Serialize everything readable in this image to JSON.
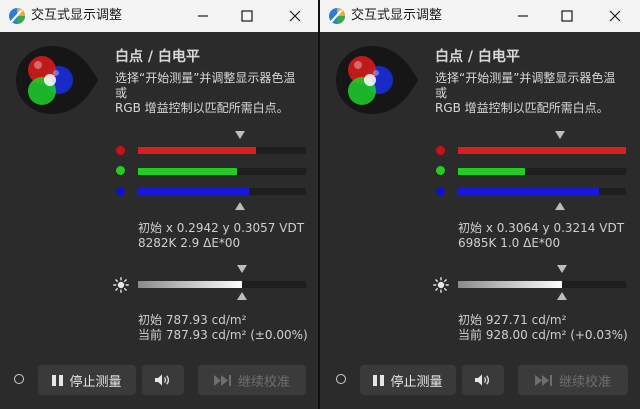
{
  "windows": [
    {
      "title": "交互式显示调整",
      "heading": "白点 / 白电平",
      "description": [
        "选择“开始测量”并调整显示器色温",
        "或",
        "RGB 增益控制以匹配所需白点。"
      ],
      "channels": [
        {
          "name": "red",
          "color": "#d81e1e",
          "dot_color": "#cc1111",
          "level": 0.7
        },
        {
          "name": "green",
          "color": "#22cc22",
          "dot_color": "#22cc22",
          "level": 0.59
        },
        {
          "name": "blue",
          "color": "#1818dd",
          "dot_color": "#1212cc",
          "level": 0.66
        }
      ],
      "target_marker": 0.61,
      "readout_color": [
        "初始 x 0.2942 y 0.3057 VDT",
        "8282K 2.9 ΔE*00"
      ],
      "brightness_level": 0.62,
      "brightness_marker": 0.62,
      "readout_luminance": [
        "初始 787.93 cd/m²",
        "当前 787.93 cd/m² (±0.00%)"
      ],
      "buttons": {
        "stop": "停止测量",
        "continue": "继续校准"
      }
    },
    {
      "title": "交互式显示调整",
      "heading": "白点 / 白电平",
      "description": [
        "选择“开始测量”并调整显示器色温",
        "或",
        "RGB 增益控制以匹配所需白点。"
      ],
      "channels": [
        {
          "name": "red",
          "color": "#d81e1e",
          "dot_color": "#cc1111",
          "level": 1.0
        },
        {
          "name": "green",
          "color": "#22cc22",
          "dot_color": "#22cc22",
          "level": 0.4
        },
        {
          "name": "blue",
          "color": "#1818dd",
          "dot_color": "#1212cc",
          "level": 0.84
        }
      ],
      "target_marker": 0.61,
      "readout_color": [
        "初始 x 0.3064 y 0.3214 VDT",
        "6985K 1.0 ΔE*00"
      ],
      "brightness_level": 0.62,
      "brightness_marker": 0.62,
      "readout_luminance": [
        "初始 927.71 cd/m²",
        "当前 928.00 cd/m² (+0.03%)"
      ],
      "buttons": {
        "stop": "停止测量",
        "continue": "继续校准"
      }
    }
  ],
  "icons": {
    "app": "color-wheel-icon",
    "minimize": "minimize-icon",
    "maximize": "maximize-icon",
    "close": "close-icon",
    "brightness": "sun-icon",
    "pause": "pause-icon",
    "speaker": "speaker-icon",
    "skip": "skip-forward-icon",
    "status": "status-circle-icon"
  },
  "colors": {
    "window_bg": "#2b2b2b",
    "titlebar_bg": "#f3f3f3",
    "track_bg": "#1e1e1e",
    "text": "#d8d8d8",
    "button_bg": "#3a3a3a",
    "disabled_text": "#6e6e6e"
  }
}
